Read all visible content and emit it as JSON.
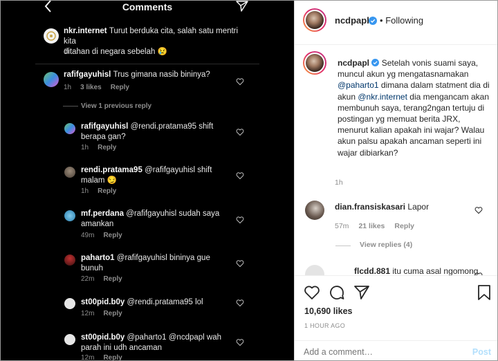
{
  "left": {
    "title": "Comments",
    "comments": [
      {
        "user": "nkr.internet",
        "text": "Turut berduka cita, salah satu mentri kita",
        "text2": "ditahan di negara sebelah 😢",
        "time": "1h"
      },
      {
        "user": "rafifgayuhisl",
        "text": "Trus gimana nasib bininya?",
        "time": "1h",
        "likes": "3 likes",
        "reply": "Reply"
      },
      {
        "user": "rafifgayuhisl",
        "text": "@rendi.pratama95 shift",
        "text2": "berapa gan?",
        "time": "1h",
        "reply": "Reply"
      },
      {
        "user": "rendi.pratama95",
        "text": "@rafifgayuhisl shift",
        "text2": "malam 😏",
        "time": "1h",
        "reply": "Reply"
      },
      {
        "user": "mf.perdana",
        "text": "@rafifgayuhisl sudah saya",
        "text2": "amankan",
        "time": "49m",
        "reply": "Reply"
      },
      {
        "user": "paharto1",
        "text": "@rafifgayuhisl bininya gue",
        "text2": "bunuh",
        "time": "22m",
        "reply": "Reply"
      },
      {
        "user": "st00pid.b0y",
        "text": "@rendi.pratama95 lol",
        "time": "12m",
        "reply": "Reply"
      },
      {
        "user": "st00pid.b0y",
        "text": "@paharto1 @ncdpapl wah",
        "text2": "parah ini udh ancaman",
        "time": "12m",
        "reply": "Reply"
      }
    ],
    "view_previous": "View 1 previous reply"
  },
  "right": {
    "header": {
      "username": "ncdpapl",
      "separator": "•",
      "follow": "Following"
    },
    "caption": {
      "username": "ncdpapl",
      "part1": "Setelah vonis suami saya, muncul akun yg mengatasnamakan",
      "mention1": "@paharto1",
      "part2": "dimana dalam statment dia di akun",
      "mention2": "@nkr.internet",
      "part3": "dia mengancam akan membunuh saya, terang2ngan tertuju di postingan yg memuat berita JRX, menurut kalian apakah ini wajar? Walau akun palsu apakah ancaman seperti ini wajar dibiarkan?",
      "time": "1h"
    },
    "comment1": {
      "user": "dian.fransiskasari",
      "text": "Lapor",
      "time": "57m",
      "likes": "21 likes",
      "reply": "Reply"
    },
    "view_replies": "View replies (4)",
    "comment2": {
      "user": "flcdd.881",
      "text": "itu cuma asal ngomong"
    },
    "likes": "10,690 likes",
    "ago": "1 HOUR AGO",
    "add_comment_placeholder": "Add a comment…",
    "post": "Post"
  },
  "colors": {
    "dark_bg": "#000000",
    "mention": "#00376b",
    "verified": "#3897f0",
    "post_disabled": "#b2dffc"
  }
}
